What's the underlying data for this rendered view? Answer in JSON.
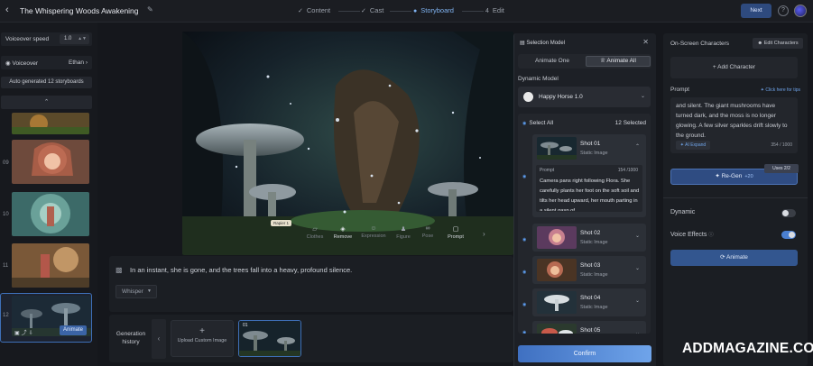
{
  "header": {
    "back_icon": "chevron-left-icon",
    "title": "The Whispering Woods Awakening",
    "steps": [
      {
        "num": "",
        "label": "Content"
      },
      {
        "num": "",
        "label": "Cast"
      },
      {
        "num": "",
        "label": "Storyboard"
      },
      {
        "num": "4",
        "label": "Edit"
      }
    ],
    "active_step": "Storyboard",
    "next_label": "Next"
  },
  "sidebar": {
    "voiceover_speed_label": "Voiceover speed",
    "voiceover_speed_value": "1.0",
    "voiceover_label": "Voiceover",
    "voiceover_value": "Ethan",
    "generated_note": "Auto generated 12 storyboards",
    "thumb_numbers": [
      "09",
      "10",
      "11",
      "12"
    ],
    "selected_animate_label": "Animate"
  },
  "toolbar": {
    "tag": "Rapier 1",
    "tools": [
      "Clothes",
      "Remove",
      "Expression",
      "Figure",
      "Pose",
      "Prompt"
    ],
    "active_tool": "Prompt"
  },
  "narration": {
    "text": "In an instant, she is gone, and the trees fall into a heavy, profound silence.",
    "voice": "Whisper"
  },
  "history": {
    "label_line1": "Generation",
    "label_line2": "history",
    "upload_label": "Upload Custom Image",
    "thumb_label": "01"
  },
  "selection_panel": {
    "title": "Selection Model",
    "tabs": [
      "Animate One",
      "Animate All"
    ],
    "active_tab": "Animate All",
    "dynamic_model_label": "Dynamic Model",
    "model_name": "Happy Horse 1.0",
    "select_all_label": "Select All",
    "selected_count": "12 Selected",
    "shots": [
      {
        "name": "Shot 01",
        "sub": "Static Image",
        "expanded": true
      },
      {
        "name": "Shot 02",
        "sub": "Static Image"
      },
      {
        "name": "Shot 03",
        "sub": "Static Image"
      },
      {
        "name": "Shot 04",
        "sub": "Static Image"
      },
      {
        "name": "Shot 05",
        "sub": ""
      }
    ],
    "shot1_prompt_label": "Prompt",
    "shot1_prompt_count": "154 /1000",
    "shot1_prompt_text": "Camera pans right following Flora. She carefully plants her foot on the soft soil and tilts her head upward, her mouth parting in a silent gasp of",
    "confirm_label": "Confirm"
  },
  "right_panel": {
    "characters_title": "On-Screen Characters",
    "edit_characters_label": "Edit Characters",
    "add_character_label": "Add Character",
    "prompt_label": "Prompt",
    "tips_label": "Click here for tips",
    "prompt_text": "and silent. The giant mushrooms have turned dark, and the moss is no longer glowing. A few silver sparkles drift slowly to the ground.",
    "ai_expand_label": "AI Expand",
    "prompt_count": "354 / 1000",
    "uses_label": "Uses  2/2",
    "regen_label": "Re-Gen",
    "regen_cost": "+20",
    "dynamic_label": "Dynamic",
    "dynamic_on": false,
    "voice_effects_label": "Voice Effects",
    "voice_effects_on": true,
    "animate_label": "Animate"
  },
  "watermark": "ADDMAGAZINE.CO.UK",
  "colors": {
    "accent": "#5ea0f5",
    "button_blue": "#2f4c82",
    "background": "#15171c"
  }
}
